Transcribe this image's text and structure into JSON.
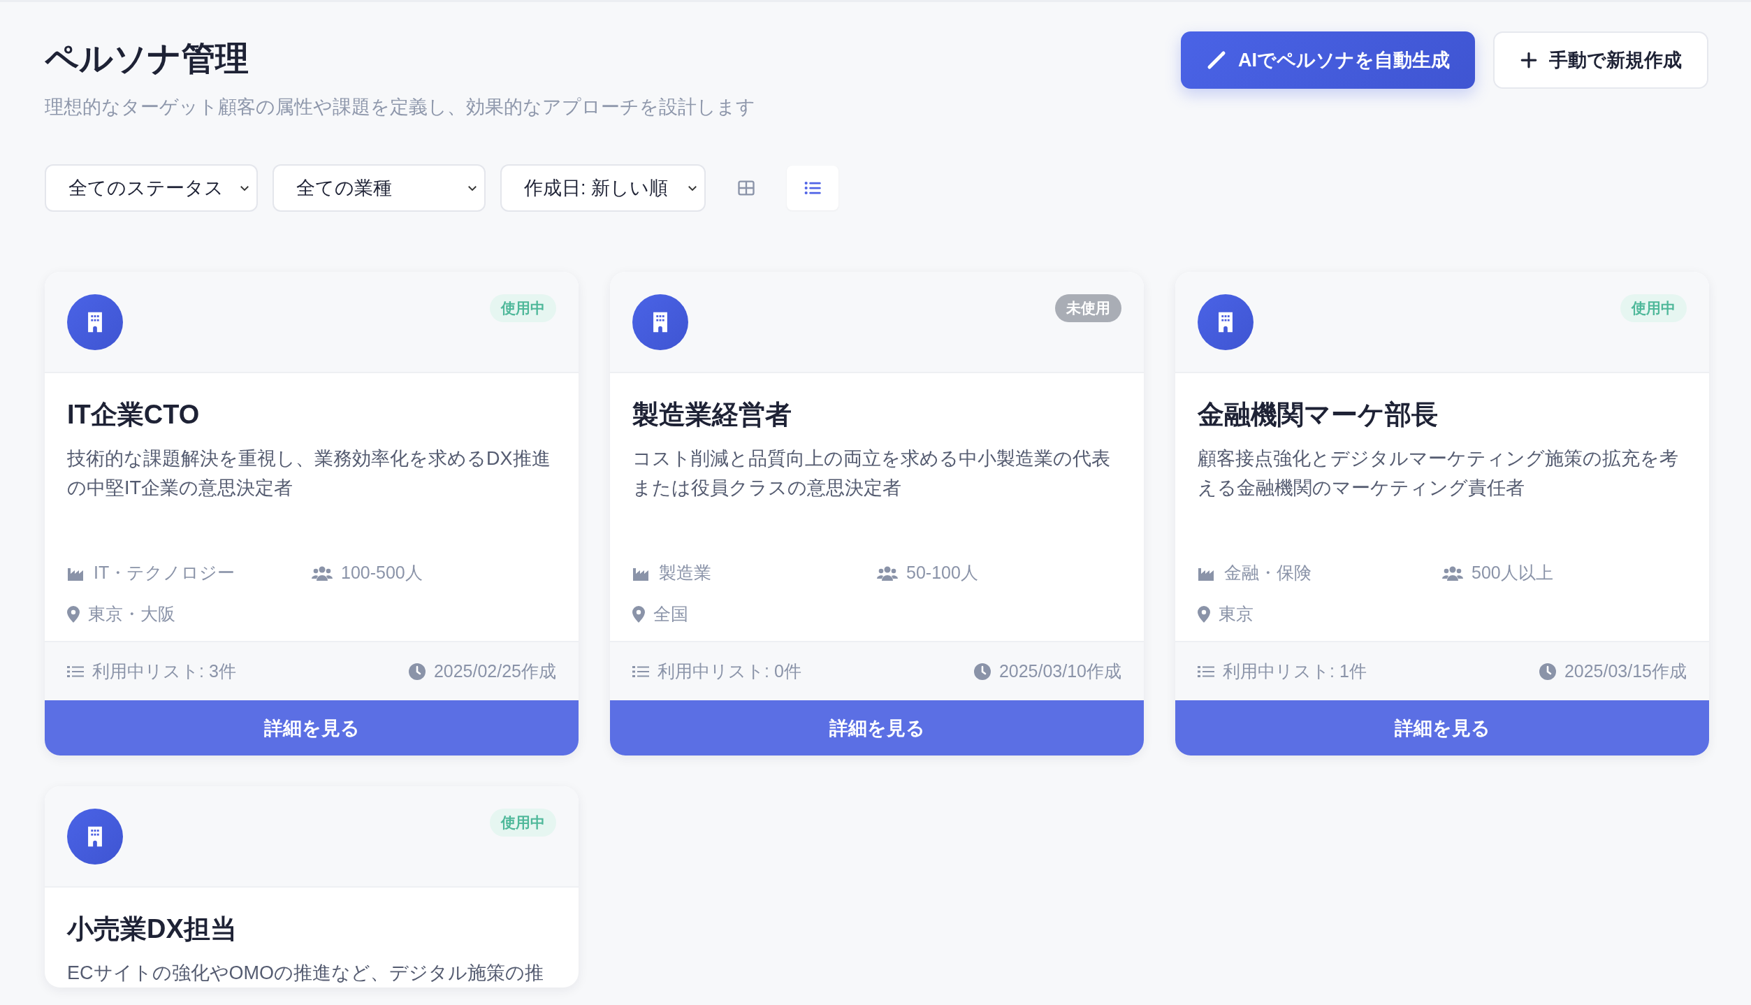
{
  "page": {
    "title": "ペルソナ管理",
    "subtitle": "理想的なターゲット顧客の属性や課題を定義し、効果的なアプローチを設計します"
  },
  "actions": [
    {
      "kind": "ai",
      "label": "AIでペルソナを自動生成"
    },
    {
      "kind": "manual",
      "label": "手動で新規作成"
    }
  ],
  "filters": [
    {
      "value": "全てのステータス"
    },
    {
      "value": "全ての業種"
    },
    {
      "value": "作成日: 新しい順"
    }
  ],
  "views": [
    {
      "kind": "grid",
      "selected": false
    },
    {
      "kind": "list",
      "selected": true
    }
  ],
  "personas": [
    {
      "status": {
        "label": "使用中",
        "kind": "active"
      },
      "name": "IT企業CTO",
      "description": "技術的な課題解決を重視し、業務効率化を求めるDX推進の中堅IT企業の意思決定者",
      "industry": "IT・テクノロジー",
      "size": "100-500人",
      "region": "東京・大阪",
      "lists": "利用中リスト: 3件",
      "created": "2025/02/25作成",
      "button": "詳細を見る"
    },
    {
      "status": {
        "label": "未使用",
        "kind": "unused"
      },
      "name": "製造業経営者",
      "description": "コスト削減と品質向上の両立を求める中小製造業の代表または役員クラスの意思決定者",
      "industry": "製造業",
      "size": "50-100人",
      "region": "全国",
      "lists": "利用中リスト: 0件",
      "created": "2025/03/10作成",
      "button": "詳細を見る"
    },
    {
      "status": {
        "label": "使用中",
        "kind": "active"
      },
      "name": "金融機関マーケ部長",
      "description": "顧客接点強化とデジタルマーケティング施策の拡充を考える金融機関のマーケティング責任者",
      "industry": "金融・保険",
      "size": "500人以上",
      "region": "東京",
      "lists": "利用中リスト: 1件",
      "created": "2025/03/15作成",
      "button": "詳細を見る"
    },
    {
      "status": {
        "label": "使用中",
        "kind": "active"
      },
      "name": "小売業DX担当",
      "description": "ECサイトの強化やOMOの推進など、デジタル施策の推"
    }
  ]
}
